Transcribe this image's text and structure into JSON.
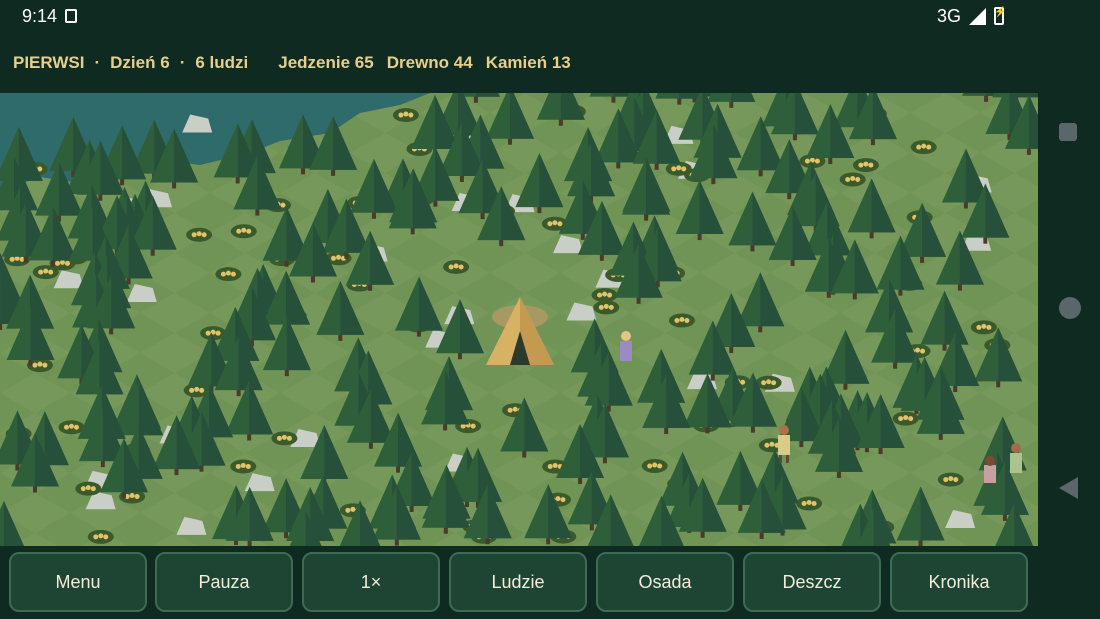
{
  "status": {
    "time": "9:14",
    "network": "3G"
  },
  "hud": {
    "settlement": "PIERWSI",
    "day": "Dzień 6",
    "people": "6 ludzi",
    "food": "Jedzenie 65",
    "wood": "Drewno 44",
    "stone": "Kamień 13",
    "separator": "·"
  },
  "toolbar": {
    "buttons": [
      "Menu",
      "Pauza",
      "1×",
      "Ludzie",
      "Osada",
      "Deszcz",
      "Kronika"
    ]
  },
  "colors": {
    "background": "#0f2a20",
    "hud_text": "#e6cf8e",
    "grass": "#6f9455",
    "water": "#2f6b6a",
    "tree": "#2f5e3a",
    "button": "#1e4434"
  }
}
